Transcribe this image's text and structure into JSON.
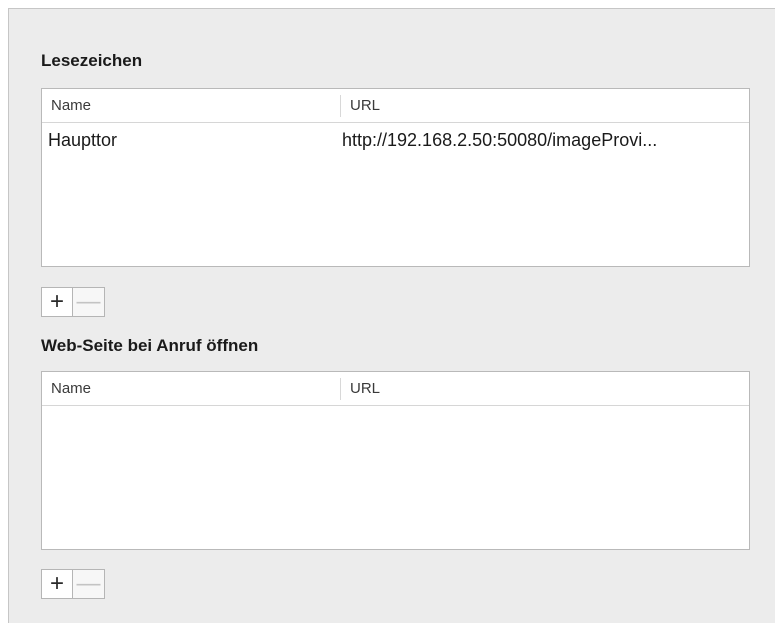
{
  "bookmarks": {
    "title": "Lesezeichen",
    "columns": {
      "name": "Name",
      "url": "URL"
    },
    "rows": [
      {
        "name": "Haupttor",
        "url": "http://192.168.2.50:50080/imageProvi..."
      }
    ],
    "add_label": "+",
    "remove_label": "—"
  },
  "open_page": {
    "title": "Web-Seite bei Anruf öffnen",
    "columns": {
      "name": "Name",
      "url": "URL"
    },
    "rows": [],
    "add_label": "+",
    "remove_label": "—"
  }
}
